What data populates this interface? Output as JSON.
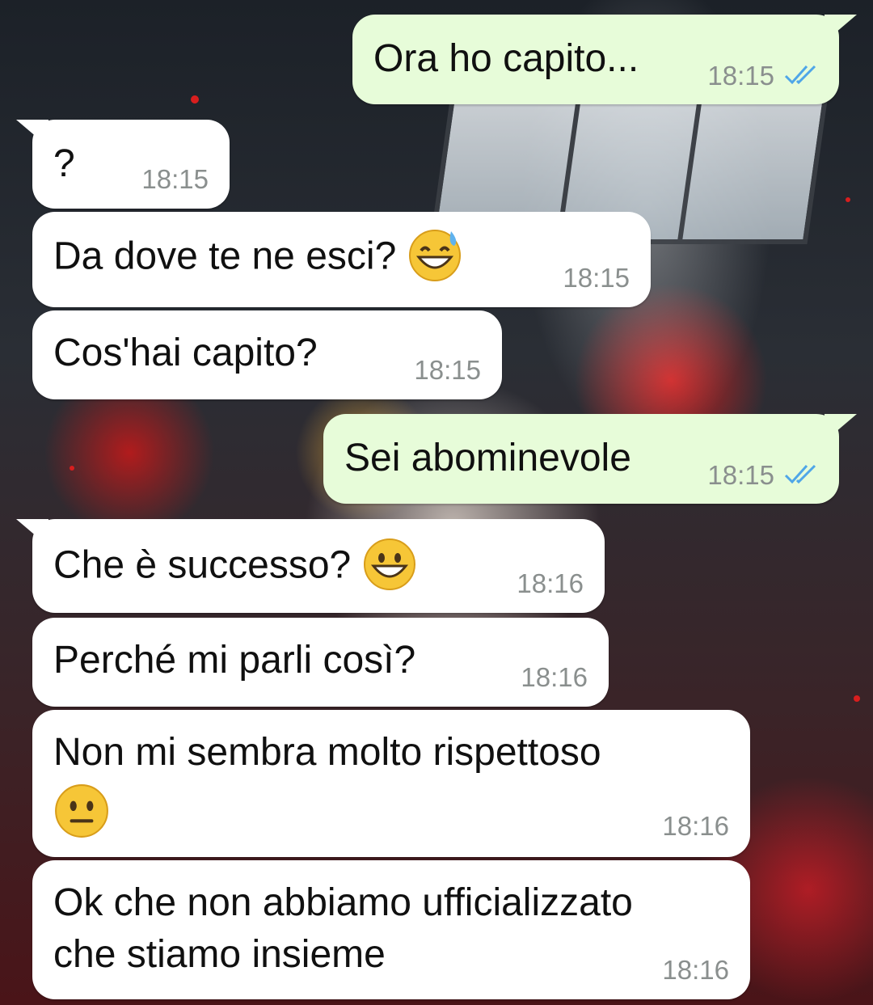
{
  "chat": {
    "messages": [
      {
        "direction": "outgoing",
        "text": "Ora ho capito...",
        "time": "18:15",
        "status": "read"
      },
      {
        "direction": "incoming",
        "text": "?",
        "time": "18:15"
      },
      {
        "direction": "incoming",
        "text": "Da dove te ne esci?",
        "emoji": "grinning-face-with-sweat",
        "time": "18:15"
      },
      {
        "direction": "incoming",
        "text": "Cos'hai capito?",
        "time": "18:15"
      },
      {
        "direction": "outgoing",
        "text": "Sei abominevole",
        "time": "18:15",
        "status": "read"
      },
      {
        "direction": "incoming",
        "text": "Che è successo?",
        "emoji": "grinning-face",
        "time": "18:16"
      },
      {
        "direction": "incoming",
        "text": "Perché mi parli così?",
        "time": "18:16"
      },
      {
        "direction": "incoming",
        "text": "Non mi sembra molto rispettoso",
        "emoji": "neutral-face",
        "time": "18:16"
      },
      {
        "direction": "incoming",
        "text": "Ok che non abbiamo ufficializzato",
        "text_line2": "che stiamo insieme",
        "time": "18:16"
      }
    ]
  },
  "colors": {
    "incoming_bubble": "#ffffff",
    "outgoing_bubble": "#e7fcd9",
    "timestamp": "#8a8f8e",
    "read_ticks": "#4fa6e8"
  }
}
